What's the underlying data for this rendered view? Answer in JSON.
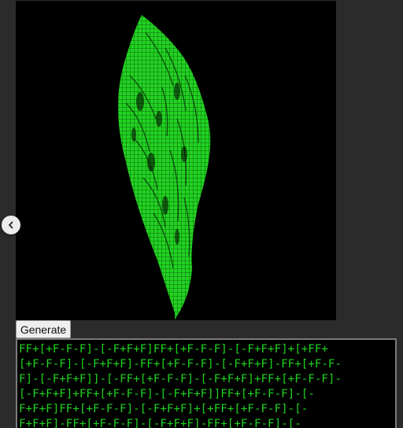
{
  "controls": {
    "generate_label": "Generate"
  },
  "nav": {
    "prev_icon": "chevron-left-icon"
  },
  "output": {
    "lines": [
      "FF+[+F-F-F]-[-F+F+F]FF+[+F-F-F]-[-F+F+F]+[+FF+",
      "[+F-F-F]-[-F+F+F]-FF+[+F-F-F]-[-F+F+F]-FF+[+F-F-",
      "F]-[-F+F+F]]-[-FF+[+F-F-F]-[-F+F+F]+FF+[+F-F-F]-",
      "[-F+F+F]+FF+[+F-F-F]-[-F+F+F]]FF+[+F-F-F]-[-",
      "F+F+F]FF+[+F-F-F]-[-F+F+F]+[+FF+[+F-F-F]-[-",
      "F+F+F]-FF+[+F-F-F]-[-F+F+F]-FF+[+F-F-F]-[-"
    ]
  },
  "colors": {
    "background": "#2b2b2b",
    "canvas": "#000000",
    "plant": "#22e822",
    "text": "#1fd51f"
  }
}
